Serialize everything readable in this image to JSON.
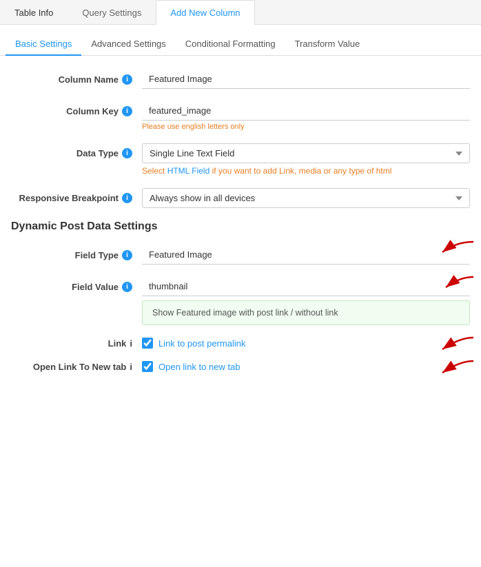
{
  "topTabs": [
    {
      "label": "Table Info",
      "active": false
    },
    {
      "label": "Query Settings",
      "active": false
    },
    {
      "label": "Add New Column",
      "active": true
    }
  ],
  "subTabs": [
    {
      "label": "Basic Settings",
      "active": true
    },
    {
      "label": "Advanced Settings",
      "active": false
    },
    {
      "label": "Conditional Formatting",
      "active": false
    },
    {
      "label": "Transform Value",
      "active": false
    }
  ],
  "fields": {
    "columnName": {
      "label": "Column Name",
      "value": "Featured Image"
    },
    "columnKey": {
      "label": "Column Key",
      "value": "featured_image",
      "hint": "Please use english letters only"
    },
    "dataType": {
      "label": "Data Type",
      "value": "Single Line Text Field",
      "hint": "Select HTML Field if you want to add Link, media or any type of html"
    },
    "responsiveBreakpoint": {
      "label": "Responsive Breakpoint",
      "value": "Always show in all devices"
    }
  },
  "dynamicSection": {
    "heading": "Dynamic Post Data Settings",
    "fieldType": {
      "label": "Field Type",
      "value": "Featured Image"
    },
    "fieldValue": {
      "label": "Field Value",
      "value": "thumbnail"
    },
    "infoBox": "Show Featured image with post link / without link",
    "link": {
      "label": "Link",
      "checkboxLabel": "Link to post permalink",
      "checked": true
    },
    "openNewTab": {
      "label": "Open Link To New tab",
      "checkboxLabel": "Open link to new tab",
      "checked": true
    }
  }
}
